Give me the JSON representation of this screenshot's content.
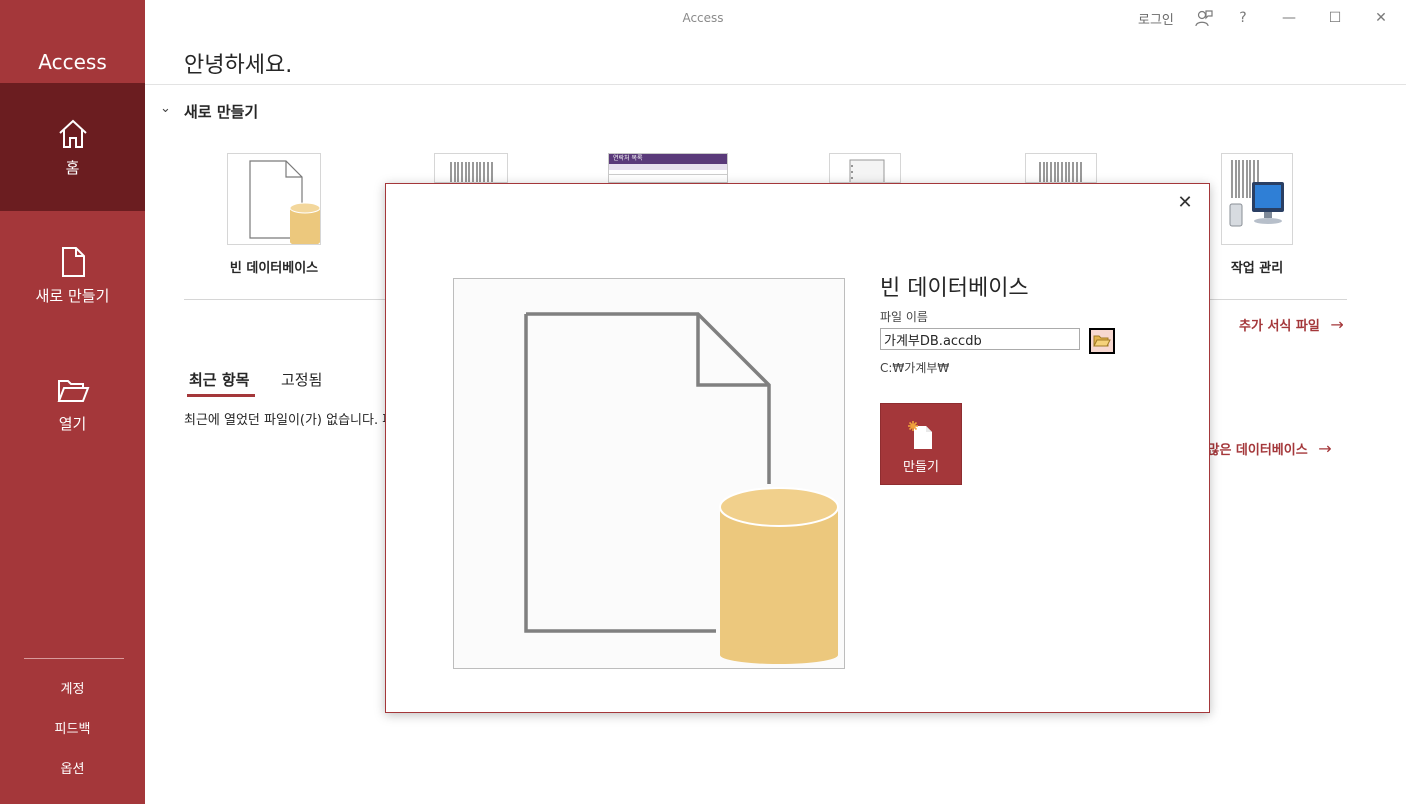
{
  "app": {
    "name": "Access",
    "window_title": "Access"
  },
  "titlebar": {
    "signin": "로그인",
    "help": "?",
    "minimize": "—",
    "maximize": "☐",
    "close": "✕"
  },
  "sidebar": {
    "items": [
      {
        "label": "홈",
        "icon": "home-icon",
        "active": true
      },
      {
        "label": "새로 만들기",
        "icon": "new-file-icon",
        "active": false
      },
      {
        "label": "열기",
        "icon": "open-folder-icon",
        "active": false
      }
    ],
    "bottom": [
      {
        "label": "계정"
      },
      {
        "label": "피드백"
      },
      {
        "label": "옵션"
      }
    ]
  },
  "main": {
    "greeting": "안녕하세요.",
    "new_section": {
      "toggle": "⌄",
      "title": "새로 만들기"
    },
    "templates": [
      {
        "label": "빈 데이터베이스"
      },
      {
        "label": ""
      },
      {
        "label": ""
      },
      {
        "label": ""
      },
      {
        "label": ""
      },
      {
        "label": "작업 관리"
      }
    ],
    "contacts_thumb_title": "연락처 목록",
    "more_templates": "추가 서식 파일",
    "more_databases": "더 많은 데이터베이스",
    "arrow": "→",
    "tabs": [
      {
        "label": "최근 항목",
        "active": true
      },
      {
        "label": "고정됨",
        "active": false
      }
    ],
    "no_recent": "최근에 열었던 파일이(가) 없습니다. 파"
  },
  "dialog": {
    "close": "✕",
    "title": "빈 데이터베이스",
    "file_name_label": "파일 이름",
    "file_name_value": "가계부DB.accdb",
    "path": "C:₩가계부₩",
    "create_label": "만들기"
  },
  "colors": {
    "accent": "#a4373a",
    "accent_dark": "#6b1d20",
    "db_fill": "#ecc87d"
  }
}
